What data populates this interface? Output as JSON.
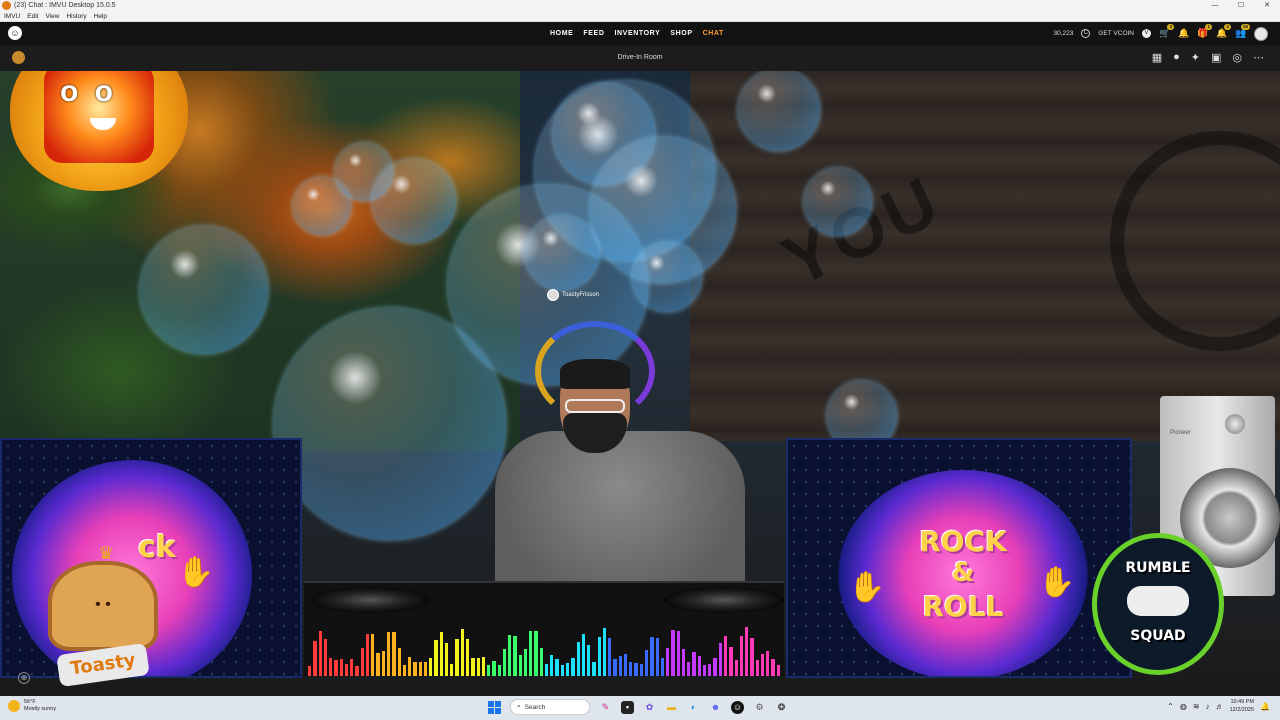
{
  "window": {
    "title": "(23) Chat : IMVU Desktop 15.0.5",
    "controls": [
      "—",
      "☐",
      "✕"
    ]
  },
  "menu": [
    "IMVU",
    "Edit",
    "View",
    "History",
    "Help"
  ],
  "nav": {
    "links": [
      "HOME",
      "FEED",
      "INVENTORY",
      "SHOP",
      "CHAT"
    ],
    "active": "CHAT",
    "credits": "30,223",
    "get_vcoin": "GET VCOIN",
    "badges": [
      "3",
      "1",
      "2",
      "25"
    ]
  },
  "room": {
    "title": "Drive-In Room"
  },
  "scene": {
    "avatar_tag": "ToastyFrisson",
    "wall_text": "YOU",
    "panel_right_text": [
      "ROCK",
      "&",
      "ROLL"
    ],
    "panel_left_text": "ck",
    "mascot_label": "Toasty",
    "logo_text": [
      "RUMBLE",
      "SQUAD"
    ],
    "speaker_brand": "Pioneer"
  },
  "taskbar": {
    "weather_temp": "56°F",
    "weather_desc": "Mostly sunny",
    "search_placeholder": "Search",
    "time": "10:49 PM",
    "date": "12/2/2025"
  },
  "colors": {
    "accent": "#ff9a2e",
    "nav_bg": "#121212",
    "room_bar_bg": "#1c1c1c",
    "taskbar_bg": "#dfe5ec"
  }
}
